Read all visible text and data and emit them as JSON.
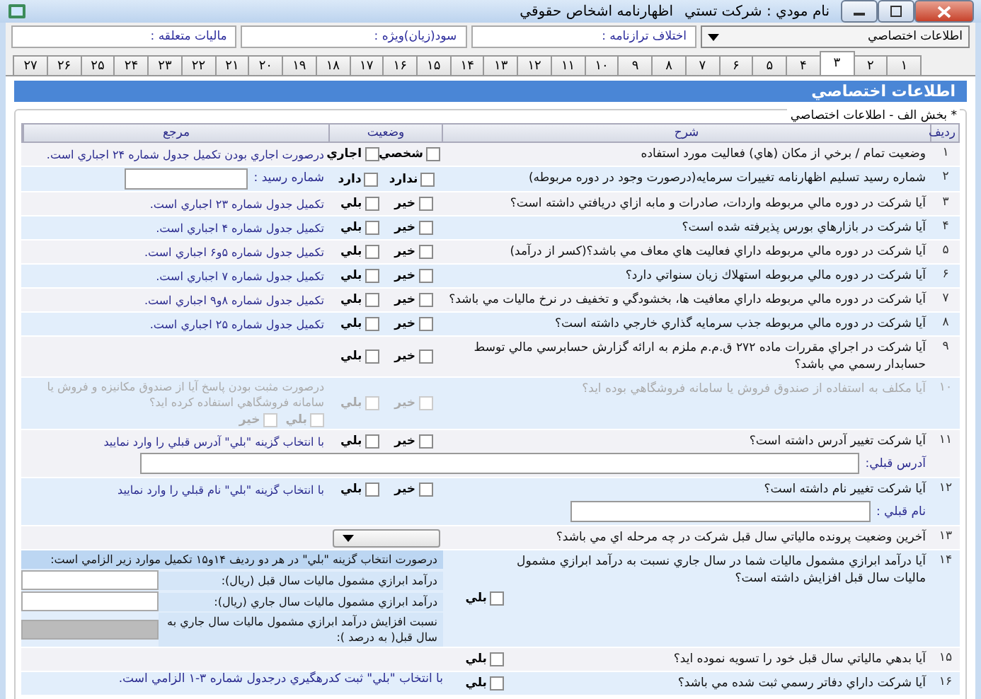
{
  "window": {
    "title": "اظهارنامه اشخاص حقوقي",
    "taxpayer": "نام مودي : شركت تستي"
  },
  "section_select": {
    "value": "اطلاعات اختصاصي"
  },
  "header_fields": [
    {
      "label": "اختلاف ترازنامه :"
    },
    {
      "label": "سود(زيان)ويژه :"
    },
    {
      "label": "ماليات متعلقه :"
    }
  ],
  "tabs": [
    {
      "label": "۱",
      "selected": false
    },
    {
      "label": "۲",
      "selected": false
    },
    {
      "label": "۳",
      "selected": true
    },
    {
      "label": "۴",
      "selected": false
    },
    {
      "label": "۵",
      "selected": false
    },
    {
      "label": "۶",
      "selected": false
    },
    {
      "label": "۷",
      "selected": false
    },
    {
      "label": "۸",
      "selected": false
    },
    {
      "label": "۹",
      "selected": false
    },
    {
      "label": "۱۰",
      "selected": false
    },
    {
      "label": "۱۱",
      "selected": false
    },
    {
      "label": "۱۲",
      "selected": false
    },
    {
      "label": "۱۳",
      "selected": false
    },
    {
      "label": "۱۴",
      "selected": false
    },
    {
      "label": "۱۵",
      "selected": false
    },
    {
      "label": "۱۶",
      "selected": false
    },
    {
      "label": "۱۷",
      "selected": false
    },
    {
      "label": "۱۸",
      "selected": false
    },
    {
      "label": "۱۹",
      "selected": false
    },
    {
      "label": "۲۰",
      "selected": false
    },
    {
      "label": "۲۱",
      "selected": false
    },
    {
      "label": "۲۲",
      "selected": false
    },
    {
      "label": "۲۳",
      "selected": false
    },
    {
      "label": "۲۴",
      "selected": false
    },
    {
      "label": "۲۵",
      "selected": false
    },
    {
      "label": "۲۶",
      "selected": false
    },
    {
      "label": "۲۷",
      "selected": false
    }
  ],
  "panel_title": "اطلاعات اختصاصي",
  "group_title": "* بخش الف - اطلاعات اختصاصي",
  "table": {
    "columns": [
      "رديف",
      "شرح",
      "وضعيت",
      "مرجع"
    ],
    "rows": [
      {
        "number": "۱",
        "kind": "options",
        "disabled": false,
        "description": "وضعيت تمام / برخي از مكان (هاي) فعاليت مورد استفاده",
        "options": [
          {
            "label": "شخصي",
            "checked": false
          },
          {
            "label": "اجاري",
            "checked": false
          }
        ],
        "reference": "درصورت اجاري بودن تكميل جدول شماره ۲۴ اجباري است."
      },
      {
        "number": "۲",
        "kind": "receipt",
        "disabled": false,
        "description": "شماره رسيد تسليم اظهارنامه تغييرات سرمايه(درصورت وجود در دوره مربوطه)",
        "options": [
          {
            "label": "ندارد",
            "checked": false
          },
          {
            "label": "دارد",
            "checked": false
          }
        ],
        "receipt_label": "شماره رسيد :"
      },
      {
        "number": "۳",
        "kind": "options",
        "disabled": false,
        "description": "آيا شركت در دوره مالي مربوطه واردات، صادرات و مابه ازاي دريافتي داشته است؟",
        "options": [
          {
            "label": "خير",
            "checked": false
          },
          {
            "label": "بلي",
            "checked": false
          }
        ],
        "reference": "تكميل جدول شماره ۲۳ اجباري است."
      },
      {
        "number": "۴",
        "kind": "options",
        "disabled": false,
        "description": "آيا شركت در بازارهاي بورس پذيرفته شده است؟",
        "options": [
          {
            "label": "خير",
            "checked": false
          },
          {
            "label": "بلي",
            "checked": false
          }
        ],
        "reference": "تكميل جدول شماره ۴ اجباري است."
      },
      {
        "number": "۵",
        "kind": "options",
        "disabled": false,
        "description": "آيا شركت در دوره مالي مربوطه داراي فعاليت هاي معاف مي باشد؟(كسر از درآمد)",
        "options": [
          {
            "label": "خير",
            "checked": false
          },
          {
            "label": "بلي",
            "checked": false
          }
        ],
        "reference": "تكميل جدول شماره ۵و۶ اجباري است."
      },
      {
        "number": "۶",
        "kind": "options",
        "disabled": false,
        "description": "آيا شركت در دوره مالي مربوطه استهلاك زيان سنواتي دارد؟",
        "options": [
          {
            "label": "خير",
            "checked": false
          },
          {
            "label": "بلي",
            "checked": false
          }
        ],
        "reference": "تكميل جدول شماره ۷ اجباري است."
      },
      {
        "number": "۷",
        "kind": "options",
        "disabled": false,
        "description": "آيا شركت در دوره مالي مربوطه داراي معافيت ها، بخشودگي و تخفيف در نرخ ماليات مي باشد؟",
        "options": [
          {
            "label": "خير",
            "checked": false
          },
          {
            "label": "بلي",
            "checked": false
          }
        ],
        "reference": "تكميل جدول شماره ۸و۹ اجباري است."
      },
      {
        "number": "۸",
        "kind": "options",
        "disabled": false,
        "description": "آيا شركت در دوره مالي مربوطه جذب سرمايه گذاري خارجي داشته است؟",
        "options": [
          {
            "label": "خير",
            "checked": false
          },
          {
            "label": "بلي",
            "checked": false
          }
        ],
        "reference": "تكميل جدول شماره ۲۵ اجباري است."
      },
      {
        "number": "۹",
        "kind": "options",
        "disabled": false,
        "description": "آيا شركت در اجراي مقررات ماده ۲۷۲ ق.م.م ملزم به ارائه گزارش حسابرسي مالي توسط حسابدار رسمي مي باشد؟",
        "options": [
          {
            "label": "خير",
            "checked": false
          },
          {
            "label": "بلي",
            "checked": false
          }
        ]
      },
      {
        "number": "۱۰",
        "kind": "sub-options",
        "disabled": true,
        "description": "آيا مكلف به استفاده از صندوق فروش يا سامانه فروشگاهي بوده ايد؟",
        "options": [
          {
            "label": "خير",
            "checked": false
          },
          {
            "label": "بلي",
            "checked": false
          }
        ],
        "reference": "درصورت مثبت بودن پاسخ آيا از صندوق مكانيزه و فروش يا سامانه فروشگاهي استفاده كرده ايد؟",
        "sub_options": [
          {
            "label": "بلي",
            "checked": false
          },
          {
            "label": "خير",
            "checked": false
          }
        ]
      },
      {
        "number": "۱۱",
        "kind": "wide-field",
        "disabled": false,
        "description": "آيا شركت تغيير آدرس داشته است؟",
        "options": [
          {
            "label": "خير",
            "checked": false
          },
          {
            "label": "بلي",
            "checked": false
          }
        ],
        "reference": "با انتخاب گزينه \"بلي\" آدرس قبلي را وارد نماييد",
        "field_label": "آدرس قبلي:"
      },
      {
        "number": "۱۲",
        "kind": "field",
        "disabled": false,
        "description": "آيا شركت تغيير نام داشته است؟",
        "options": [
          {
            "label": "خير",
            "checked": false
          },
          {
            "label": "بلي",
            "checked": false
          }
        ],
        "reference": "با انتخاب گزينه \"بلي\" نام قبلي را وارد نماييد",
        "field_label": "نام قبلي :"
      },
      {
        "number": "۱۳",
        "kind": "dropdown",
        "disabled": false,
        "description": "آخرين وضعيت پرونده مالياتي سال قبل شركت در چه مرحله اي مي باشد؟"
      },
      {
        "number": "۱۴",
        "kind": "income",
        "disabled": false,
        "description": "آيا درآمد ابرازي مشمول ماليات شما در سال جاري نسبت به درآمد ابرازي مشمول ماليات سال قبل افزايش داشته است؟",
        "options": [
          {
            "label": "بلي",
            "checked": false
          }
        ],
        "income_block": {
          "note": "درصورت انتخاب گزينه \"بلي\" در هر دو رديف ۱۴و۱۵ تكميل موارد زير الزامي است:",
          "fields": [
            {
              "label": "درآمد ابرازي مشمول ماليات سال قبل (ريال):",
              "disabled": false
            },
            {
              "label": "درآمد ابرازي مشمول ماليات سال جاري (ريال):",
              "disabled": false
            },
            {
              "label": "نسبت افزايش درآمد ابرازي مشمول ماليات سال جاري به سال قبل( به درصد ):",
              "disabled": true
            }
          ]
        }
      },
      {
        "number": "۱۵",
        "kind": "single",
        "disabled": false,
        "description": "آيا بدهي مالياتي سال قبل خود را تسويه نموده ايد؟",
        "options": [
          {
            "label": "بلي",
            "checked": false
          }
        ]
      },
      {
        "number": "۱۶",
        "kind": "single",
        "disabled": false,
        "description": "آيا شركت داراي دفاتر رسمي ثبت شده مي باشد؟",
        "options": [
          {
            "label": "بلي",
            "checked": false
          }
        ],
        "reference": "با انتخاب \"بلي\" ثبت كدرهگيري درجدول شماره ۳-۱ الزامي است."
      }
    ]
  }
}
